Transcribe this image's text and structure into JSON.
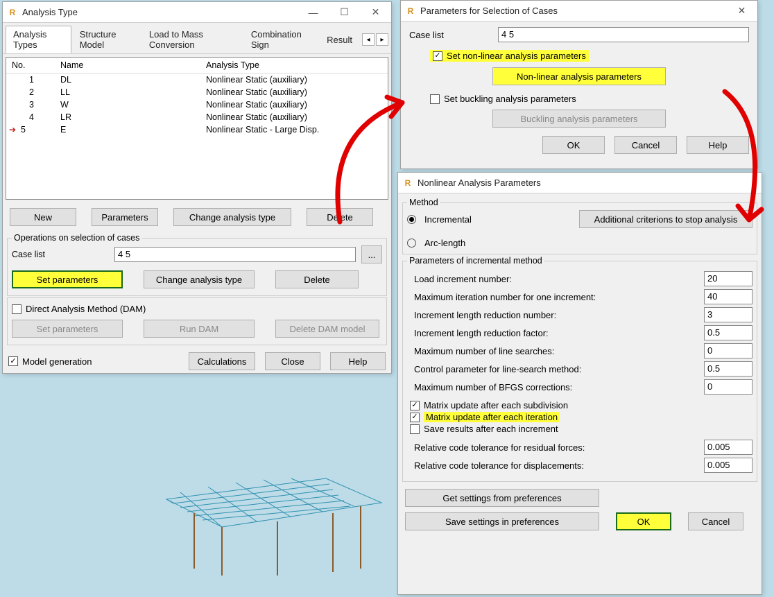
{
  "win1": {
    "title": "Analysis Type",
    "tabs": {
      "types": "Analysis Types",
      "model": "Structure Model",
      "mass": "Load to Mass Conversion",
      "combo": "Combination Sign",
      "result": "Result"
    },
    "cols": {
      "no": "No.",
      "name": "Name",
      "type": "Analysis Type"
    },
    "rows": [
      {
        "no": "1",
        "name": "DL",
        "type": "Nonlinear Static (auxiliary)"
      },
      {
        "no": "2",
        "name": "LL",
        "type": "Nonlinear Static (auxiliary)"
      },
      {
        "no": "3",
        "name": "W",
        "type": "Nonlinear Static (auxiliary)"
      },
      {
        "no": "4",
        "name": "LR",
        "type": "Nonlinear Static (auxiliary)"
      },
      {
        "no": "5",
        "name": "E",
        "type": "Nonlinear Static - Large Disp."
      }
    ],
    "btns": {
      "new": "New",
      "params": "Parameters",
      "change": "Change analysis type",
      "delete": "Delete"
    },
    "ops": {
      "legend": "Operations on selection of cases",
      "caselist_label": "Case list",
      "caselist_value": "4 5",
      "browse": "...",
      "setparams": "Set parameters",
      "change": "Change analysis type",
      "delete": "Delete"
    },
    "dam": {
      "label": "Direct Analysis Method (DAM)",
      "setparams": "Set parameters",
      "run": "Run DAM",
      "deletemodel": "Delete DAM model"
    },
    "footer": {
      "modelgen": "Model generation",
      "calcs": "Calculations",
      "close": "Close",
      "help": "Help"
    }
  },
  "win2": {
    "title": "Parameters for Selection of Cases",
    "caselist_label": "Case list",
    "caselist_value": "4 5",
    "set_nl": "Set non-linear analysis parameters",
    "nl_btn": "Non-linear analysis parameters",
    "set_buck": "Set buckling analysis parameters",
    "buck_btn": "Buckling analysis parameters",
    "ok": "OK",
    "cancel": "Cancel",
    "help": "Help"
  },
  "win3": {
    "title": "Nonlinear Analysis Parameters",
    "method_legend": "Method",
    "incremental": "Incremental",
    "arclength": "Arc-length",
    "addcrit": "Additional criterions to stop analysis",
    "params_legend": "Parameters of incremental method",
    "p": {
      "loadinc_label": "Load increment number:",
      "loadinc": "20",
      "maxiter_label": "Maximum iteration number for one increment:",
      "maxiter": "40",
      "redn_label": "Increment length reduction number:",
      "redn": "3",
      "redf_label": "Increment length reduction factor:",
      "redf": "0.5",
      "maxls_label": "Maximum number of line searches:",
      "maxls": "0",
      "ctrlls_label": "Control parameter for line-search method:",
      "ctrlls": "0.5",
      "bfgs_label": "Maximum number of BFGS corrections:",
      "bfgs": "0"
    },
    "matrix_sub": "Matrix update after each subdivision",
    "matrix_iter": "Matrix update after each iteration",
    "save_inc": "Save results after each increment",
    "tol_force_label": "Relative code tolerance for residual forces:",
    "tol_force": "0.005",
    "tol_disp_label": "Relative code tolerance for displacements:",
    "tol_disp": "0.005",
    "get_pref": "Get settings from preferences",
    "save_pref": "Save settings in preferences",
    "ok": "OK",
    "cancel": "Cancel"
  }
}
